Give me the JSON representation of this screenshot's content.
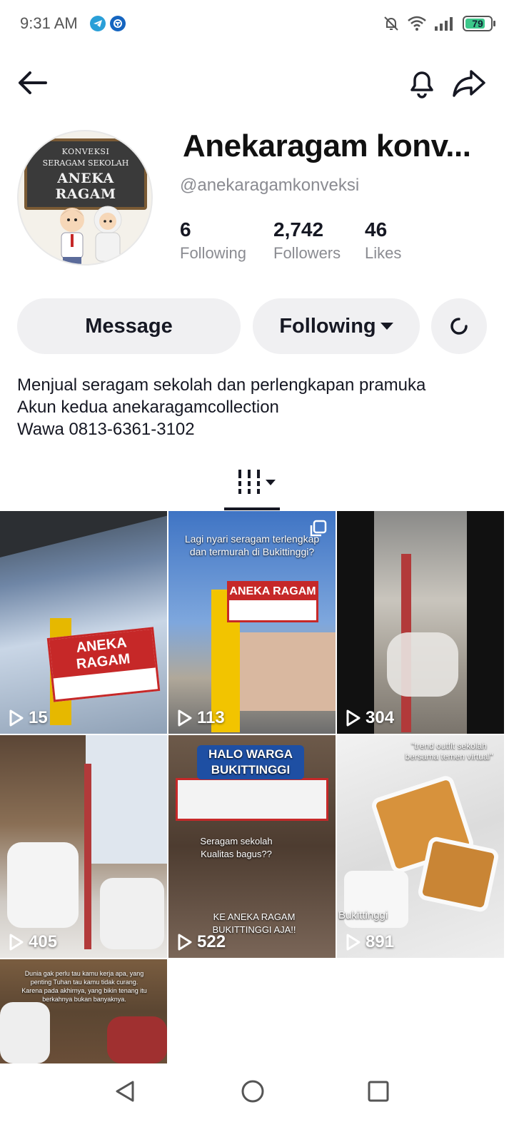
{
  "status_bar": {
    "time": "9:31 AM",
    "battery": "79",
    "battery_level": 0.79
  },
  "nav": {
    "back_icon": "arrow-left-icon",
    "bell_icon": "bell-icon",
    "share_icon": "share-icon"
  },
  "profile": {
    "display_name": "Anekaragam konv...",
    "handle": "@anekaragamkonveksi",
    "avatar": {
      "line1": "KONVEKSI",
      "line2": "SERAGAM SEKOLAH",
      "line3": "ANEKA RAGAM"
    },
    "stats": [
      {
        "value": "6",
        "label": "Following"
      },
      {
        "value": "2,742",
        "label": "Followers"
      },
      {
        "value": "46",
        "label": "Likes"
      }
    ]
  },
  "actions": {
    "message": "Message",
    "following": "Following"
  },
  "bio": {
    "line1": "Menjual seragam sekolah dan perlengkapan pramuka",
    "line2": "Akun kedua anekaragamcollection",
    "line3": "Wawa 0813-6361-3102"
  },
  "videos": [
    {
      "views": "15",
      "sign": "ANEKA RAGAM"
    },
    {
      "views": "113",
      "caption": "Lagi nyari seragam terlengkap dan termurah di Bukittinggi?",
      "sign": "ANEKA RAGAM"
    },
    {
      "views": "304"
    },
    {
      "views": "405"
    },
    {
      "views": "522",
      "caption_top": "HALO WARGA BUKITTINGGI",
      "caption_mid": "Seragam sekolah Kualitas bagus??",
      "caption_bottom": "KE ANEKA RAGAM BUKITTINGGI AJA!!"
    },
    {
      "views": "891",
      "caption_top": "\"trend outfit sekolah bersama temen virtual\"",
      "caption_bottom": "Bukittinggi"
    },
    {
      "caption": "Dunia gak perlu tau kamu kerja apa, yang penting Tuhan tau kamu tidak curang. Karena pada akhirnya, yang bikin tenang itu berkahnya bukan banyaknya."
    }
  ],
  "colors": {
    "accent_red": "#c62828",
    "button_bg": "#f0f0f2",
    "muted_text": "#8a8b91",
    "battery_green": "#3cc78a"
  }
}
